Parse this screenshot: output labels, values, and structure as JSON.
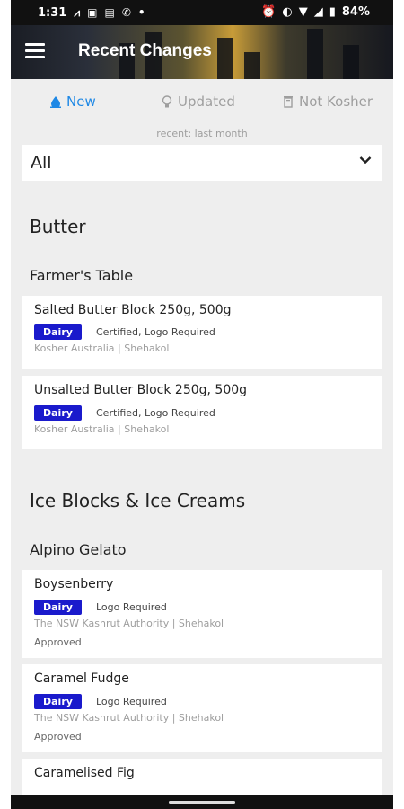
{
  "statusbar": {
    "time": "1:31",
    "battery": "84%"
  },
  "appbar": {
    "title": "Recent Changes"
  },
  "tabs": [
    {
      "label": "New",
      "icon": "drop-icon",
      "active": true
    },
    {
      "label": "Updated",
      "icon": "lightbulb-icon",
      "active": false
    },
    {
      "label": "Not Kosher",
      "icon": "trash-icon",
      "active": false
    }
  ],
  "recent_label": "recent: last month",
  "filter": {
    "value": "All"
  },
  "sections": [
    {
      "title": "Butter",
      "brand": "Farmer's Table",
      "items": [
        {
          "name": "Salted Butter Block 250g, 500g",
          "badge": "Dairy",
          "status": "Certified, Logo Required",
          "agency": "Kosher Australia | Shehakol"
        },
        {
          "name": "Unsalted Butter Block 250g, 500g",
          "badge": "Dairy",
          "status": "Certified, Logo Required",
          "agency": "Kosher Australia | Shehakol"
        }
      ]
    },
    {
      "title": "Ice Blocks & Ice Creams",
      "brand": "Alpino Gelato",
      "items": [
        {
          "name": "Boysenberry",
          "badge": "Dairy",
          "status": "Logo Required",
          "agency": "The NSW Kashrut Authority | Shehakol",
          "note": "Approved"
        },
        {
          "name": "Caramel Fudge",
          "badge": "Dairy",
          "status": "Logo Required",
          "agency": "The NSW Kashrut Authority | Shehakol",
          "note": "Approved"
        },
        {
          "name": "Caramelised Fig"
        }
      ]
    }
  ],
  "colors": {
    "accent": "#1e88e5",
    "badge": "#1a1acc"
  }
}
